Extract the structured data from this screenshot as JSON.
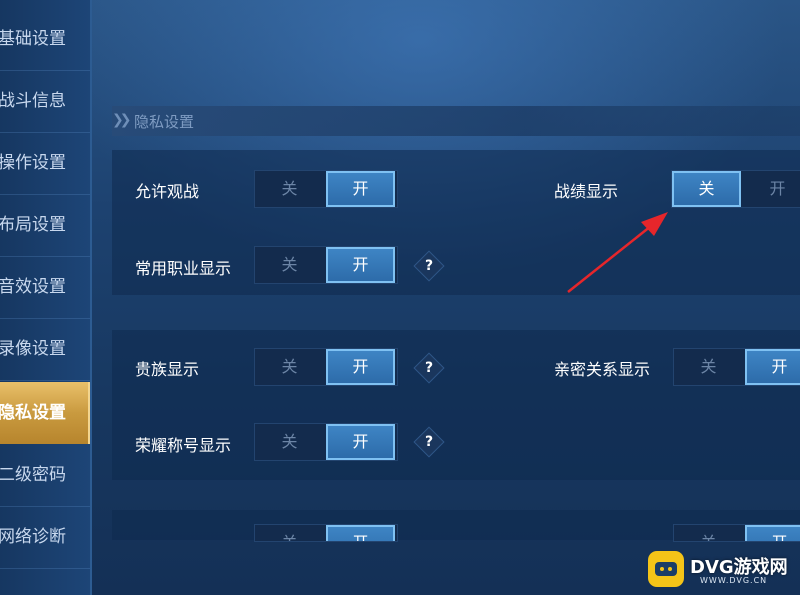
{
  "sidebar": {
    "items": [
      {
        "label": "基础设置"
      },
      {
        "label": "战斗信息"
      },
      {
        "label": "操作设置"
      },
      {
        "label": "布局设置"
      },
      {
        "label": "音效设置"
      },
      {
        "label": "录像设置"
      },
      {
        "label": "隐私设置",
        "active": true
      },
      {
        "label": "二级密码"
      },
      {
        "label": "网络诊断"
      }
    ]
  },
  "section": {
    "title": "隐私设置"
  },
  "settings": {
    "allow_spectate": {
      "label": "允许观战",
      "off": "关",
      "on": "开",
      "selected": "on"
    },
    "record_display": {
      "label": "战绩显示",
      "off": "关",
      "on": "开",
      "selected": "off"
    },
    "role_display": {
      "label": "常用职业显示",
      "off": "关",
      "on": "开",
      "selected": "on",
      "help": "?"
    },
    "noble_display": {
      "label": "贵族显示",
      "off": "关",
      "on": "开",
      "selected": "on",
      "help": "?"
    },
    "intimacy_display": {
      "label": "亲密关系显示",
      "off": "关",
      "on": "开",
      "selected": "on"
    },
    "honor_title_display": {
      "label": "荣耀称号显示",
      "off": "关",
      "on": "开",
      "selected": "on",
      "help": "?"
    },
    "partial_row": {
      "off": "关",
      "on": "开"
    },
    "partial_row_right": {
      "off": "关",
      "on": "开"
    }
  },
  "annotation": {
    "color": "#e6262b"
  },
  "watermark": {
    "text": "DVG游戏网",
    "url": "WWW.DVG.CN"
  }
}
